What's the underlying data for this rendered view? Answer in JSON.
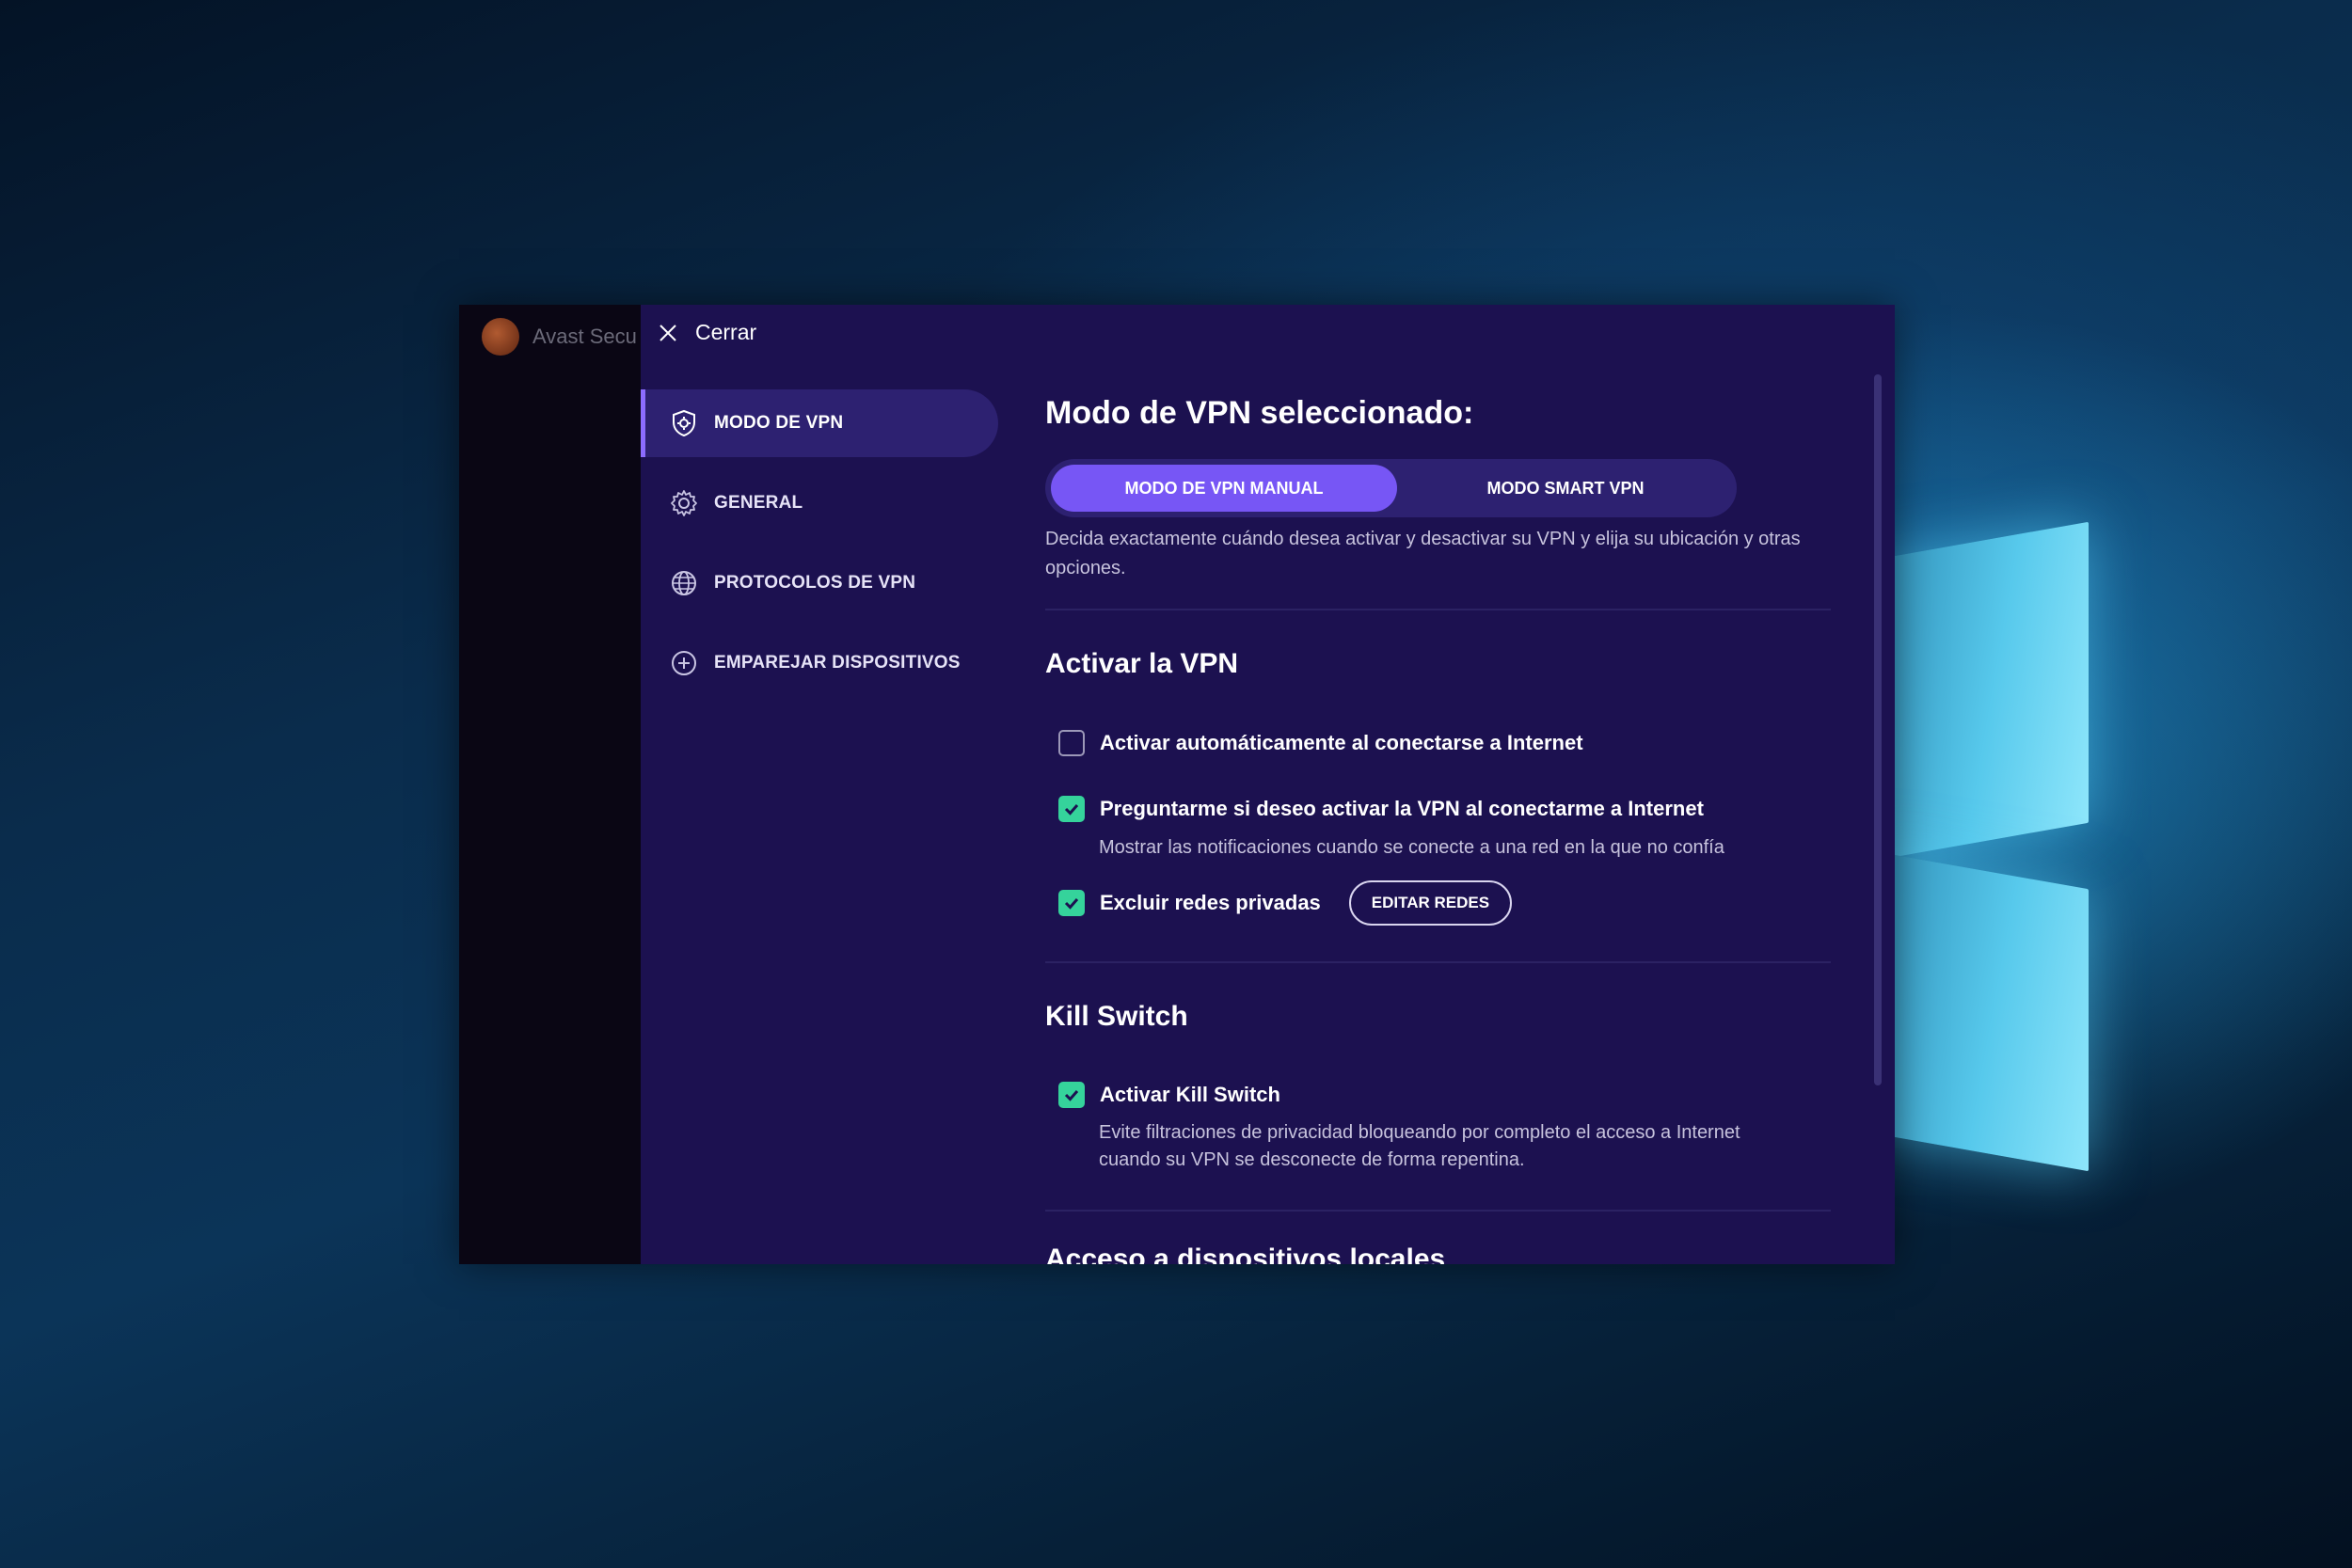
{
  "window": {
    "app_title": "Avast Secu",
    "close_label": "Cerrar"
  },
  "nav": {
    "items": [
      {
        "label": "MODO DE VPN",
        "icon": "shield-gear-icon",
        "active": true
      },
      {
        "label": "GENERAL",
        "icon": "gear-icon",
        "active": false
      },
      {
        "label": "PROTOCOLOS DE VPN",
        "icon": "globe-icon",
        "active": false
      },
      {
        "label": "EMPAREJAR DISPOSITIVOS",
        "icon": "plus-circle-icon",
        "active": false
      }
    ]
  },
  "main": {
    "title": "Modo de VPN seleccionado:",
    "mode_toggle": {
      "options": [
        "MODO DE VPN MANUAL",
        "MODO SMART VPN"
      ],
      "selected": "MODO DE VPN MANUAL"
    },
    "description": "Decida exactamente cuándo desea activar y desactivar su VPN y elija su ubicación y otras opciones.",
    "activate_section": {
      "heading": "Activar la VPN",
      "options": [
        {
          "label": "Activar automáticamente al conectarse a Internet",
          "checked": false
        },
        {
          "label": "Preguntarme si deseo activar la VPN al conectarme a Internet",
          "checked": true,
          "sub": "Mostrar las notificaciones cuando se conecte a una red en la que no confía"
        },
        {
          "label": "Excluir redes privadas",
          "checked": true,
          "button": "EDITAR REDES"
        }
      ]
    },
    "kill_switch": {
      "heading": "Kill Switch",
      "option": {
        "label": "Activar Kill Switch",
        "checked": true,
        "sub": "Evite filtraciones de privacidad bloqueando por completo el acceso a Internet cuando su VPN se desconecte de forma repentina."
      }
    },
    "next_section_heading": "Acceso a dispositivos locales"
  },
  "colors": {
    "accent": "#7756f5",
    "check": "#35d39b",
    "panel": "#1c1150"
  }
}
